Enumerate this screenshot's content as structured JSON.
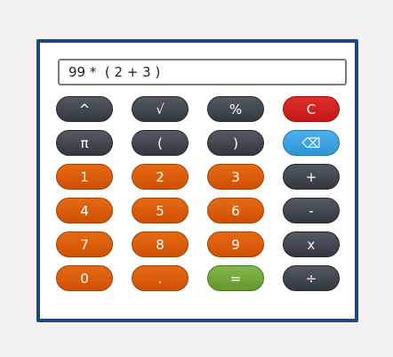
{
  "display": {
    "expression": "99 *  ( 2 + 3 )"
  },
  "keys": [
    {
      "label": "^",
      "name": "power-button",
      "style": "dark"
    },
    {
      "label": "√",
      "name": "sqrt-button",
      "style": "dark"
    },
    {
      "label": "%",
      "name": "percent-button",
      "style": "dark"
    },
    {
      "label": "C",
      "name": "clear-button",
      "style": "red"
    },
    {
      "label": "π",
      "name": "pi-button",
      "style": "dark"
    },
    {
      "label": "(",
      "name": "open-paren-button",
      "style": "dark"
    },
    {
      "label": ")",
      "name": "close-paren-button",
      "style": "dark"
    },
    {
      "label": "⌫",
      "name": "backspace-button",
      "style": "blue"
    },
    {
      "label": "1",
      "name": "digit-1-button",
      "style": "orange"
    },
    {
      "label": "2",
      "name": "digit-2-button",
      "style": "orange"
    },
    {
      "label": "3",
      "name": "digit-3-button",
      "style": "orange"
    },
    {
      "label": "+",
      "name": "add-button",
      "style": "dark"
    },
    {
      "label": "4",
      "name": "digit-4-button",
      "style": "orange"
    },
    {
      "label": "5",
      "name": "digit-5-button",
      "style": "orange"
    },
    {
      "label": "6",
      "name": "digit-6-button",
      "style": "orange"
    },
    {
      "label": "-",
      "name": "subtract-button",
      "style": "dark"
    },
    {
      "label": "7",
      "name": "digit-7-button",
      "style": "orange"
    },
    {
      "label": "8",
      "name": "digit-8-button",
      "style": "orange"
    },
    {
      "label": "9",
      "name": "digit-9-button",
      "style": "orange"
    },
    {
      "label": "x",
      "name": "multiply-button",
      "style": "dark"
    },
    {
      "label": "0",
      "name": "digit-0-button",
      "style": "orange"
    },
    {
      "label": ".",
      "name": "decimal-button",
      "style": "orange"
    },
    {
      "label": "=",
      "name": "equals-button",
      "style": "green"
    },
    {
      "label": "÷",
      "name": "divide-button",
      "style": "dark"
    }
  ],
  "colors": {
    "frame": "#1e4878",
    "operator": "#3f454c",
    "digit": "#dd5e0c",
    "clear": "#d22222",
    "backspace": "#3ea3e2",
    "equals": "#72a83b"
  }
}
